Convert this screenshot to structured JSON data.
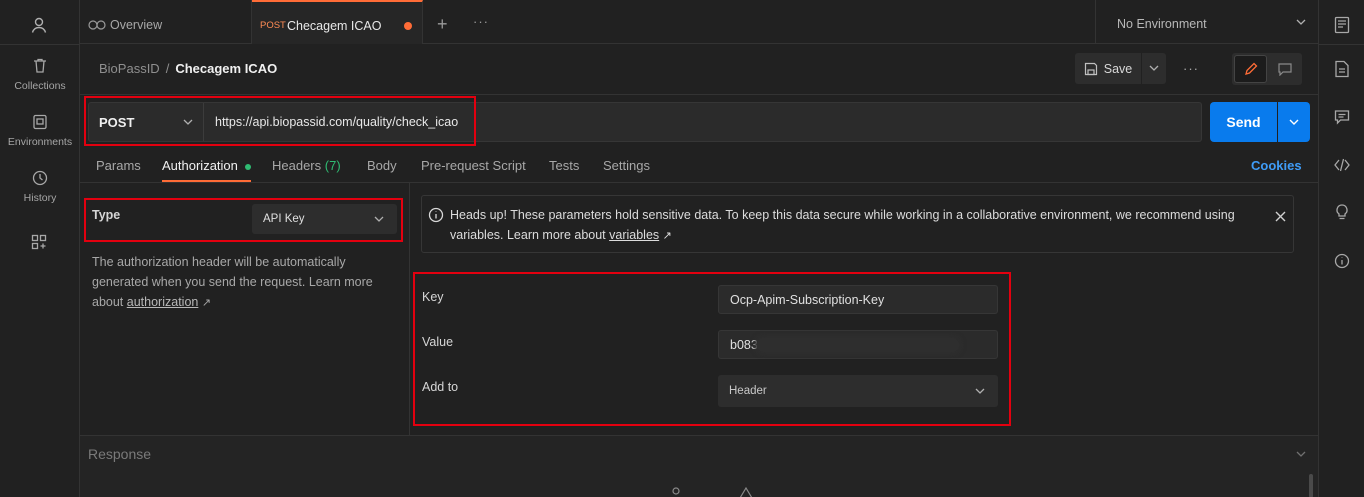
{
  "sidebar": {
    "items": [
      {
        "label": "Collections",
        "icon": "trash-can-icon"
      },
      {
        "label": "Environments",
        "icon": "environment-icon"
      },
      {
        "label": "History",
        "icon": "history-icon"
      }
    ]
  },
  "tabs": {
    "overview_label": "Overview",
    "active_method": "POST",
    "active_label": "Checagem ICAO",
    "environment": "No Environment"
  },
  "breadcrumb": {
    "parent": "BioPassID",
    "separator": "/",
    "current": "Checagem ICAO"
  },
  "toolbar": {
    "save_label": "Save"
  },
  "request": {
    "method": "POST",
    "url": "https://api.biopassid.com/quality/check_icao",
    "send_label": "Send"
  },
  "request_tabs": {
    "params": "Params",
    "authorization": "Authorization",
    "headers": "Headers",
    "headers_count": "(7)",
    "body": "Body",
    "prerequest": "Pre-request Script",
    "tests": "Tests",
    "settings": "Settings",
    "cookies": "Cookies"
  },
  "auth": {
    "type_label": "Type",
    "type_value": "API Key",
    "description": "The authorization header will be automatically generated when you send the request. Learn more about",
    "description_link": "authorization",
    "notice_text": "Heads up! These parameters hold sensitive data. To keep this data secure while working in a collaborative environment, we recommend using variables. Learn more about",
    "notice_link": "variables",
    "key_label": "Key",
    "key_value": "Ocp-Apim-Subscription-Key",
    "value_label": "Value",
    "value_value": "b083",
    "addto_label": "Add to",
    "addto_value": "Header"
  },
  "response": {
    "label": "Response"
  },
  "colors": {
    "accent": "#ff6c37",
    "send_blue": "#097bed",
    "highlight_red": "#e3000f",
    "green_dot": "#2fbb72"
  }
}
